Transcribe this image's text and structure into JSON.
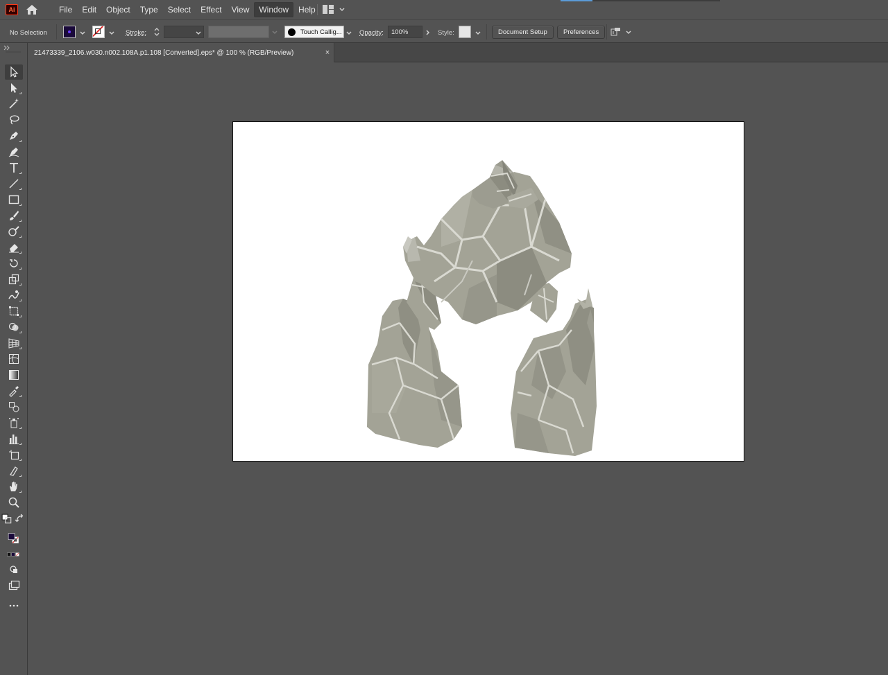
{
  "app": {
    "logo_text": "Ai",
    "menu": [
      "File",
      "Edit",
      "Object",
      "Type",
      "Select",
      "Effect",
      "View",
      "Window",
      "Help"
    ],
    "active_menu": "Window",
    "colors": {
      "accent": "#5b9bd8",
      "chrome": "#535353",
      "artboard": "#ffffff",
      "logo_border": "#ff3b1a"
    }
  },
  "control_bar": {
    "selection_status": "No Selection",
    "stroke_label": "Stroke:",
    "brush_name": "Touch Callig...",
    "opacity_label": "Opacity:",
    "opacity_value": "100%",
    "style_label": "Style:",
    "document_setup_label": "Document Setup",
    "preferences_label": "Preferences"
  },
  "document": {
    "tab_title": "21473339_2106.w030.n002.108A.p1.108 [Converted].eps* @ 100 % (RGB/Preview)",
    "close_glyph": "×"
  },
  "tools": [
    "selection-tool",
    "direct-selection-tool",
    "magic-wand-tool",
    "lasso-tool",
    "pen-tool",
    "curvature-tool",
    "type-tool",
    "line-segment-tool",
    "rectangle-tool",
    "paintbrush-tool",
    "shaper-tool",
    "eraser-tool",
    "rotate-tool",
    "scale-tool",
    "warp-tool",
    "free-transform-tool",
    "shape-builder-tool",
    "perspective-grid-tool",
    "mesh-tool",
    "gradient-tool",
    "eyedropper-tool",
    "blend-tool",
    "symbol-sprayer-tool",
    "column-graph-tool",
    "artboard-tool",
    "slice-tool",
    "hand-tool",
    "zoom-tool"
  ],
  "fill_stroke": {
    "fill_color": "#1a0a3a"
  },
  "artwork": {
    "subject": "stone-golem-illustration",
    "base_color": "#a3a396",
    "shadow_color": "#8a8a7e",
    "highlight_color": "#d7d7cf"
  }
}
